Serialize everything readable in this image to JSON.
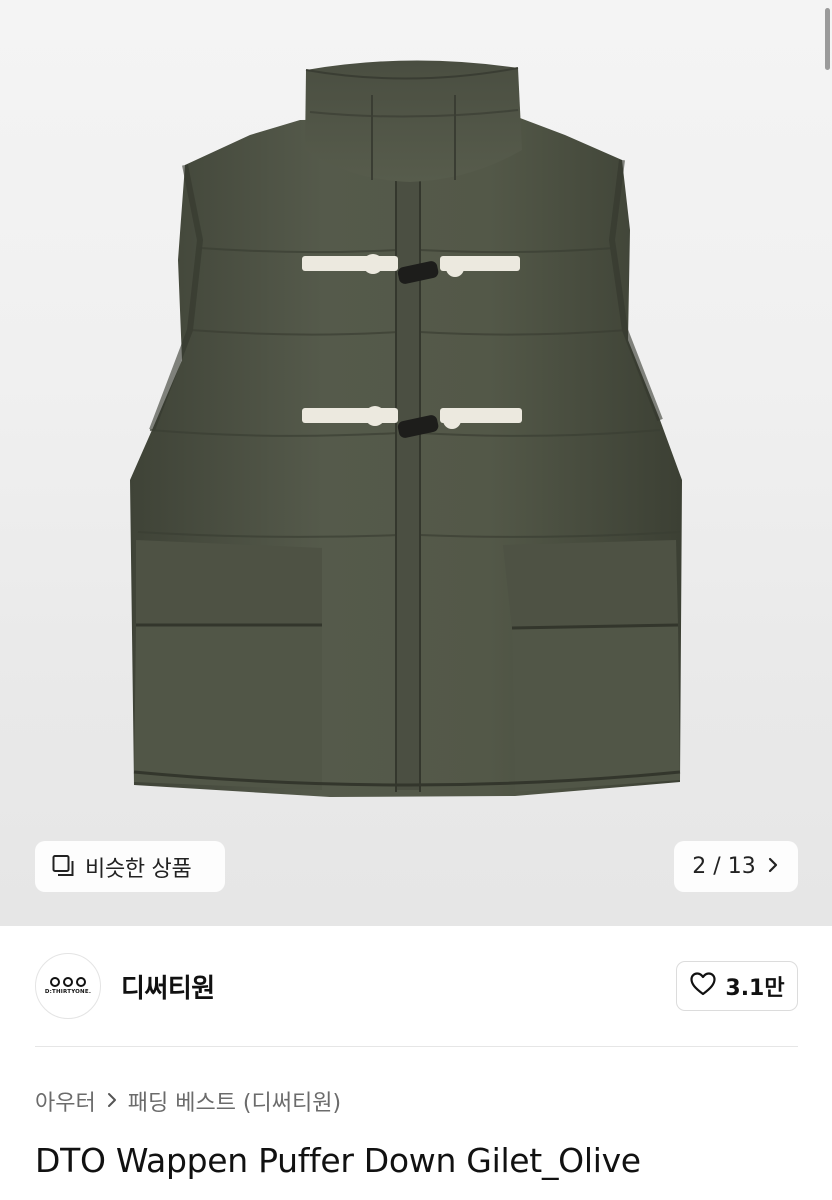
{
  "gallery": {
    "similar_label": "비슷한 상품",
    "counter": "2 / 13"
  },
  "store": {
    "logo_text": "D:THIRTYONE.",
    "name": "디써티원",
    "likes": "3.1만"
  },
  "breadcrumb": {
    "category": "아우터",
    "subcategory": "패딩 베스트 (디써티원)"
  },
  "product": {
    "title": "DTO Wappen Puffer Down Gilet_Olive"
  },
  "icons": {
    "similar": "stacked-squares-icon",
    "next": "chevron-right-icon",
    "like": "heart-icon",
    "breadcrumb_sep": "chevron-right-icon"
  },
  "colors": {
    "vest_olive": "#4f5346",
    "toggle_rope": "#ece9df"
  }
}
